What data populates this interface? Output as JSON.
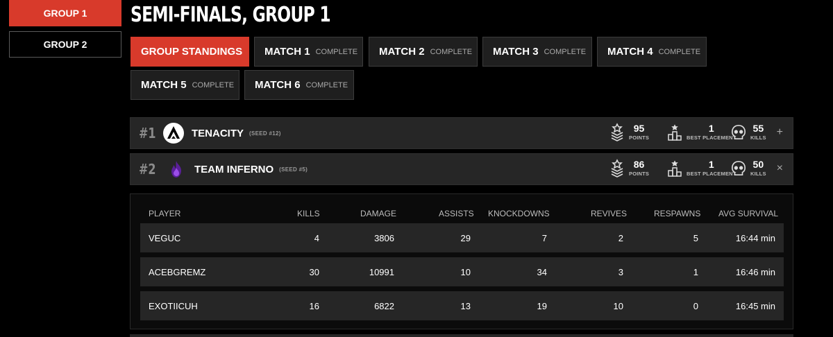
{
  "sidebar": {
    "groups": [
      {
        "label": "GROUP 1",
        "active": true
      },
      {
        "label": "GROUP 2",
        "active": false
      }
    ]
  },
  "page_title": "SEMI-FINALS, GROUP 1",
  "tabs": [
    {
      "label": "GROUP STANDINGS",
      "status": "",
      "active": true
    },
    {
      "label": "MATCH 1",
      "status": "COMPLETE",
      "active": false
    },
    {
      "label": "MATCH 2",
      "status": "COMPLETE",
      "active": false
    },
    {
      "label": "MATCH 3",
      "status": "COMPLETE",
      "active": false
    },
    {
      "label": "MATCH 4",
      "status": "COMPLETE",
      "active": false
    },
    {
      "label": "MATCH 5",
      "status": "COMPLETE",
      "active": false
    },
    {
      "label": "MATCH 6",
      "status": "COMPLETE",
      "active": false
    }
  ],
  "teams": [
    {
      "rank": "#1",
      "name": "TENACITY",
      "seed": "(SEED #12)",
      "points": "95",
      "points_label": "POINTS",
      "best_placement": "1",
      "best_placement_label": "BEST PLACEMENT",
      "kills": "55",
      "kills_label": "KILLS",
      "toggle": "+",
      "logo_icon": "apex-logo-icon"
    },
    {
      "rank": "#2",
      "name": "TEAM INFERNO",
      "seed": "(SEED #5)",
      "points": "86",
      "points_label": "POINTS",
      "best_placement": "1",
      "best_placement_label": "BEST PLACEMENT",
      "kills": "50",
      "kills_label": "KILLS",
      "toggle": "×",
      "logo_icon": "flame-logo-icon"
    }
  ],
  "player_table": {
    "headers": [
      "PLAYER",
      "KILLS",
      "DAMAGE",
      "ASSISTS",
      "KNOCKDOWNS",
      "REVIVES",
      "RESPAWNS",
      "AVG SURVIVAL"
    ],
    "rows": [
      [
        "VEGUC",
        "4",
        "3806",
        "29",
        "7",
        "2",
        "5",
        "16:44 min"
      ],
      [
        "ACEBGREMZ",
        "30",
        "10991",
        "10",
        "34",
        "3",
        "1",
        "16:46 min"
      ],
      [
        "EXOTIICUH",
        "16",
        "6822",
        "13",
        "19",
        "10",
        "0",
        "16:45 min"
      ]
    ]
  },
  "colors": {
    "accent": "#d83a2b",
    "row_bg": "#262626",
    "inferno_purple": "#7b2fd0"
  }
}
